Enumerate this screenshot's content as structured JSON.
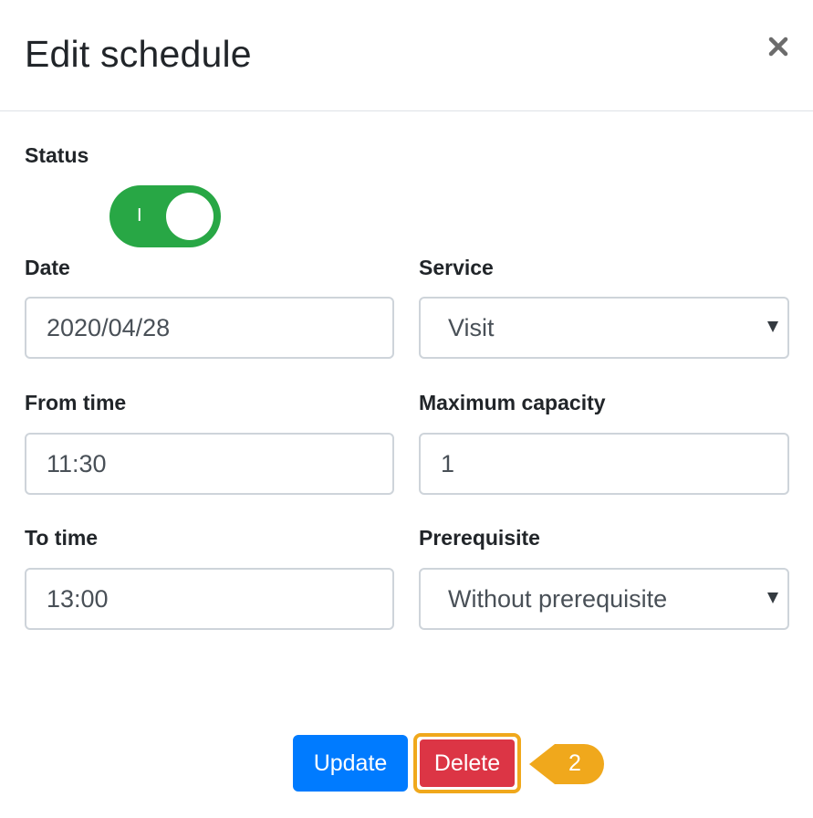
{
  "modal": {
    "title": "Edit schedule",
    "close_icon": "close-icon"
  },
  "status": {
    "label": "Status",
    "toggle_text": "I",
    "enabled": true,
    "color_on": "#28a745"
  },
  "date": {
    "label": "Date",
    "value": "2020/04/28"
  },
  "service": {
    "label": "Service",
    "value": "Visit"
  },
  "from_time": {
    "label": "From time",
    "value": "11:30"
  },
  "max_capacity": {
    "label": "Maximum capacity",
    "value": "1"
  },
  "to_time": {
    "label": "To time",
    "value": "13:00"
  },
  "prerequisite": {
    "label": "Prerequisite",
    "value": "Without prerequisite"
  },
  "actions": {
    "update_label": "Update",
    "delete_label": "Delete",
    "update_color": "#007bff",
    "delete_color": "#dc3545"
  },
  "annotation": {
    "step_number": "2",
    "color": "#f0a81c"
  }
}
